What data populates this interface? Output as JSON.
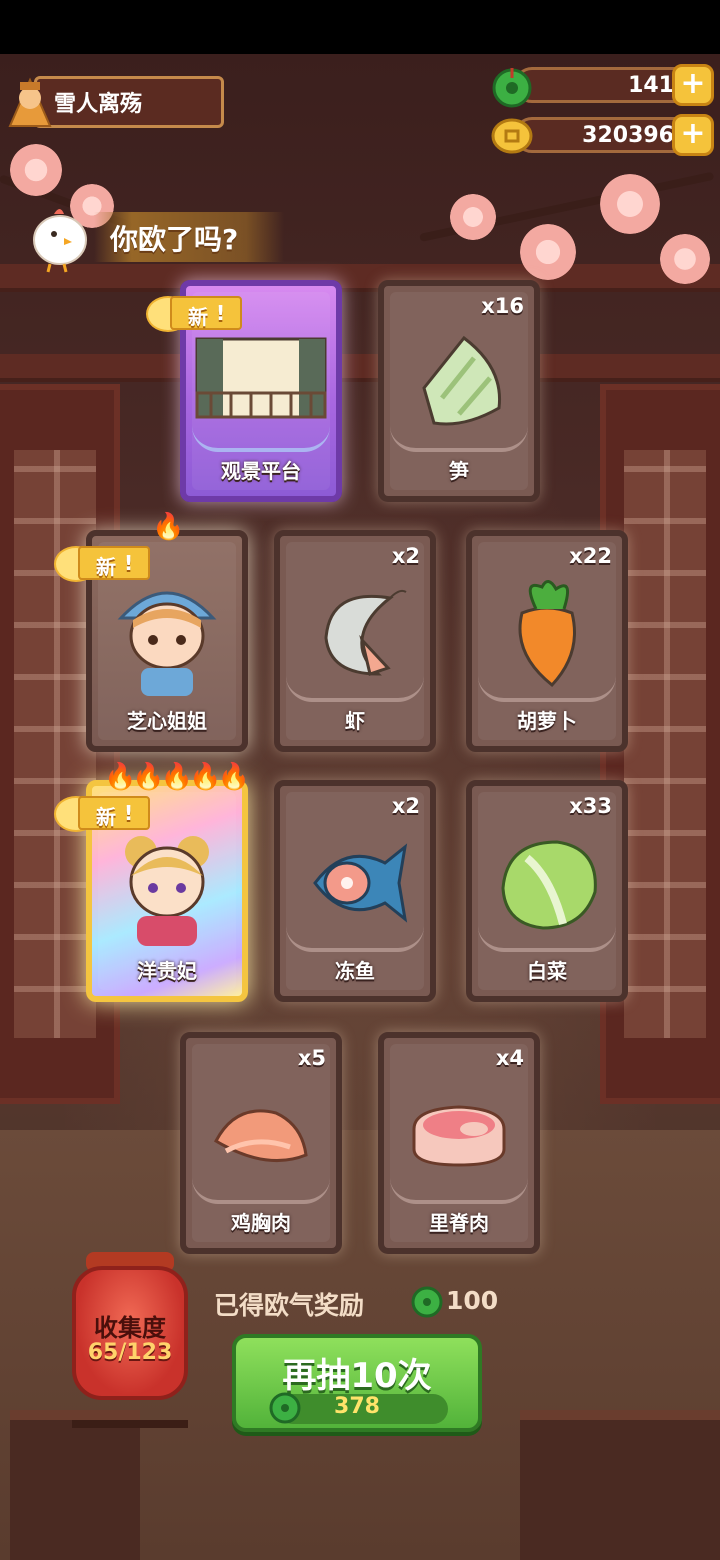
{
  "player": {
    "name": "雪人离殇"
  },
  "currency": {
    "jade": {
      "value": "141",
      "icon": "jade-coin-icon"
    },
    "coins": {
      "value": "320396",
      "icon": "gold-coin-icon"
    }
  },
  "header": {
    "text": "你欧了吗?"
  },
  "new_label": "新",
  "cards": [
    {
      "name": "观景平台",
      "count": "",
      "rarity": "purple",
      "is_new": true,
      "icon": "viewing-platform-icon"
    },
    {
      "name": "笋",
      "count": "x16",
      "rarity": "normal",
      "is_new": false,
      "icon": "bamboo-shoot-icon"
    },
    {
      "name": "芝心姐姐",
      "count": "",
      "rarity": "character",
      "is_new": true,
      "icon": "girl-character-icon",
      "flames": 1
    },
    {
      "name": "虾",
      "count": "x2",
      "rarity": "normal",
      "is_new": false,
      "icon": "shrimp-icon"
    },
    {
      "name": "胡萝卜",
      "count": "x22",
      "rarity": "normal",
      "is_new": false,
      "icon": "carrot-icon"
    },
    {
      "name": "洋贵妃",
      "count": "",
      "rarity": "rainbow",
      "is_new": true,
      "icon": "consort-character-icon",
      "flames": 5
    },
    {
      "name": "冻鱼",
      "count": "x2",
      "rarity": "normal",
      "is_new": false,
      "icon": "frozen-fish-icon"
    },
    {
      "name": "白菜",
      "count": "x33",
      "rarity": "normal",
      "is_new": false,
      "icon": "cabbage-icon"
    },
    {
      "name": "鸡胸肉",
      "count": "x5",
      "rarity": "normal",
      "is_new": false,
      "icon": "chicken-breast-icon"
    },
    {
      "name": "里脊肉",
      "count": "x4",
      "rarity": "normal",
      "is_new": false,
      "icon": "tenderloin-icon"
    }
  ],
  "collection": {
    "title": "收集度",
    "value": "65/123"
  },
  "reward": {
    "text": "已得欧气奖励",
    "value": "100"
  },
  "draw": {
    "label": "再抽10次",
    "cost": "378"
  },
  "colors": {
    "accent_green": "#52b33a",
    "gold": "#f5c33b",
    "card_frame": "#4c322c"
  }
}
